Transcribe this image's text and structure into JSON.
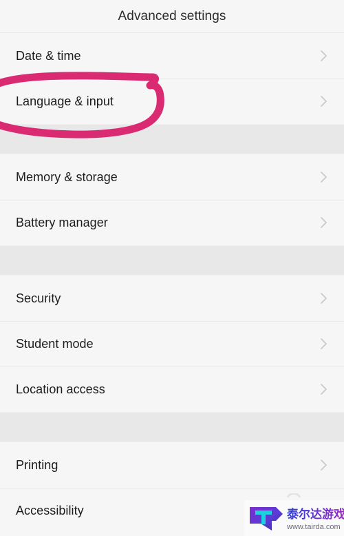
{
  "header": {
    "title": "Advanced settings"
  },
  "groups": [
    {
      "rows": [
        {
          "label": "Date & time",
          "chevron": "chevron-right-icon"
        },
        {
          "label": "Language & input",
          "chevron": "chevron-right-icon"
        }
      ]
    },
    {
      "rows": [
        {
          "label": "Memory & storage",
          "chevron": "chevron-right-icon"
        },
        {
          "label": "Battery manager",
          "chevron": "chevron-right-icon"
        }
      ]
    },
    {
      "rows": [
        {
          "label": "Security",
          "chevron": "chevron-right-icon"
        },
        {
          "label": "Student mode",
          "chevron": "chevron-right-icon"
        },
        {
          "label": "Location access",
          "chevron": "chevron-right-icon"
        }
      ]
    },
    {
      "rows": [
        {
          "label": "Printing",
          "chevron": "chevron-right-icon"
        },
        {
          "label": "Accessibility",
          "chevron": "chevron-right-icon"
        }
      ]
    }
  ],
  "annotation": {
    "name": "pink-highlight-ellipse",
    "target_label": "Language & input",
    "color": "#d92a72"
  },
  "watermark": {
    "site_name": "泰尔达游戏网",
    "url": "www.tairda.com",
    "logo_letter": "T"
  },
  "colors": {
    "row_background": "#f6f6f6",
    "gap_background": "#e8e8e8",
    "divider": "#eaeaea",
    "text": "#1d1d1d",
    "header_text": "#2b2b2b",
    "chevron": "#c9c9c9",
    "annotation_pink": "#d92a72"
  }
}
